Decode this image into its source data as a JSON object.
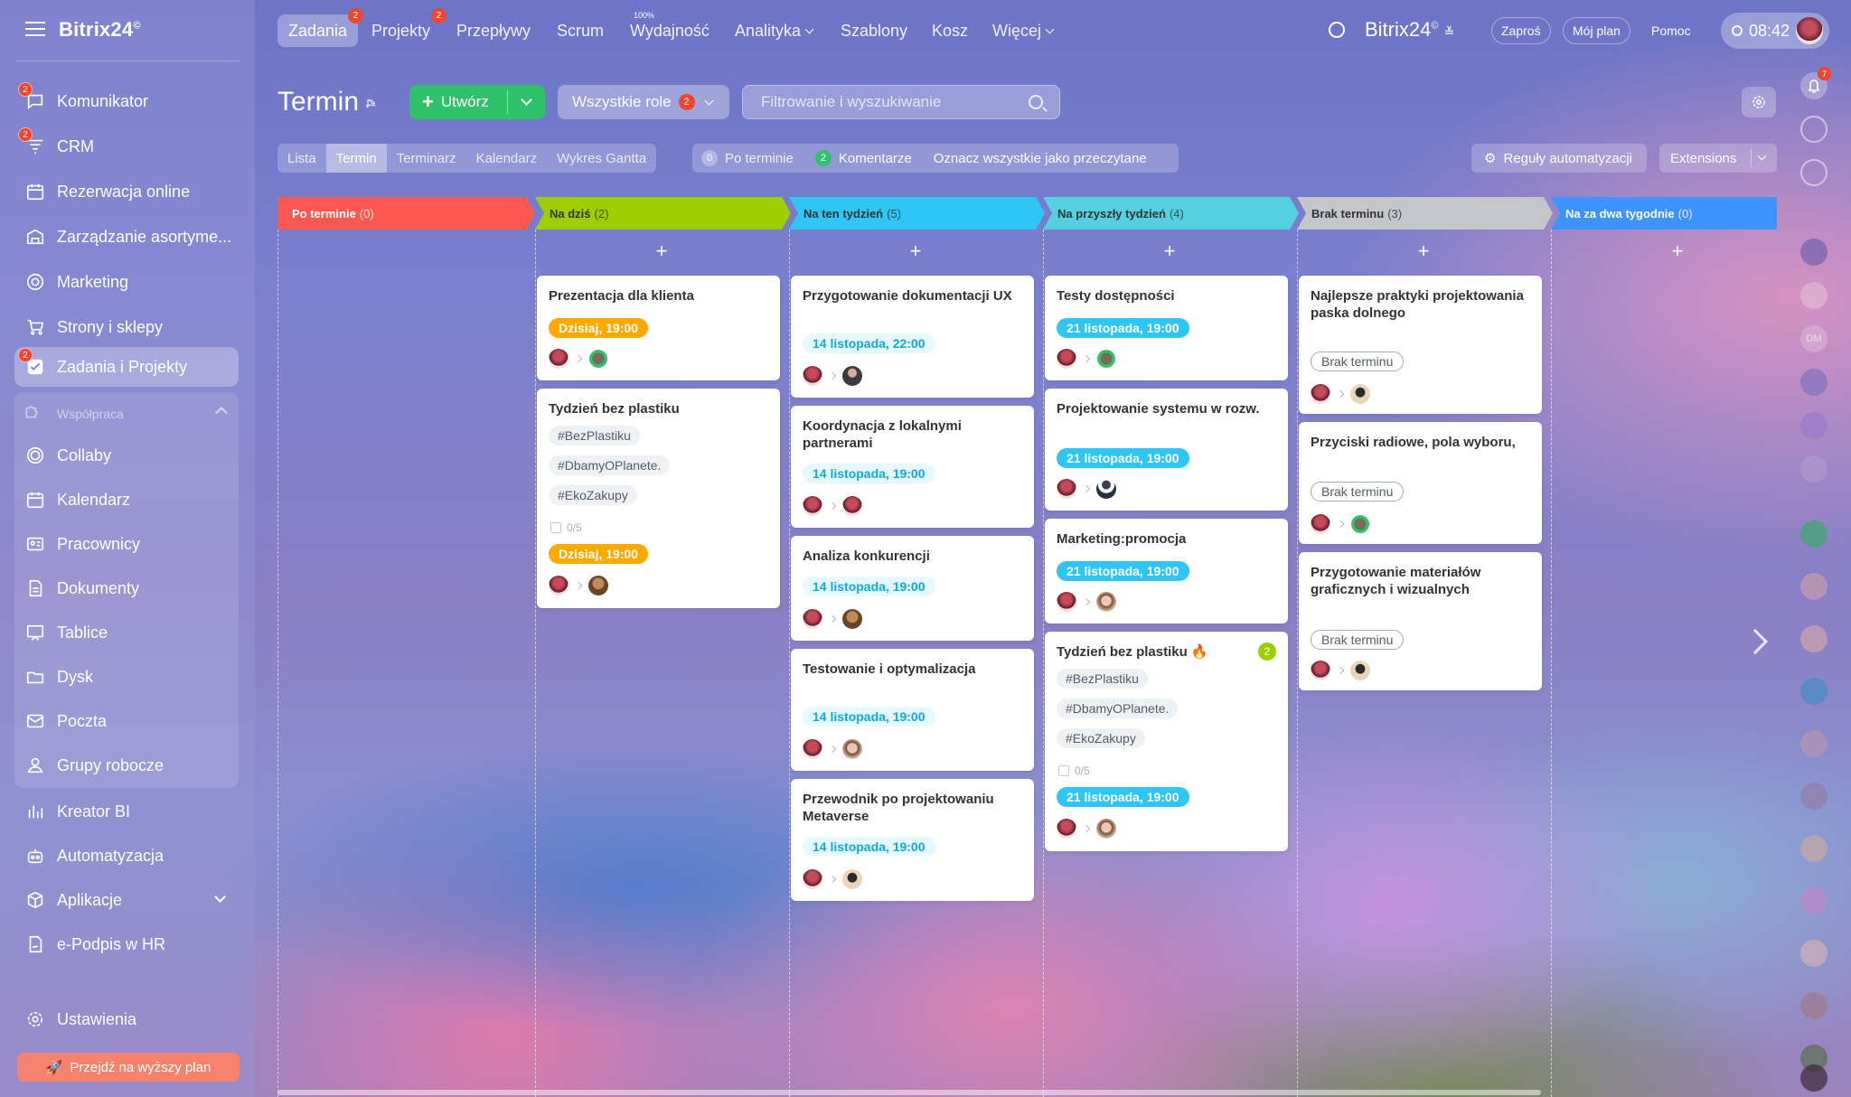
{
  "app": {
    "logo": "Bitrix24",
    "logo_mark": "©"
  },
  "sidebar": {
    "items": [
      {
        "label": "Komunikator",
        "badge": "2",
        "icon": "chat-icon"
      },
      {
        "label": "CRM",
        "badge": "2",
        "icon": "crm-funnel-icon"
      },
      {
        "label": "Rezerwacja online",
        "icon": "booking-calendar-icon"
      },
      {
        "label": "Zarządzanie asortyme...",
        "icon": "inventory-icon"
      },
      {
        "label": "Marketing",
        "icon": "target-icon"
      },
      {
        "label": "Strony i sklepy",
        "icon": "cart-icon"
      },
      {
        "label": "Zadania i Projekty",
        "badge": "2",
        "icon": "tasks-checkbox-icon"
      }
    ],
    "group_title": "Współpraca",
    "group_items": [
      {
        "label": "Collaby",
        "icon": "collab-icon"
      },
      {
        "label": "Kalendarz",
        "icon": "calendar-icon"
      },
      {
        "label": "Pracownicy",
        "icon": "employees-icon"
      },
      {
        "label": "Dokumenty",
        "icon": "documents-icon"
      },
      {
        "label": "Tablice",
        "icon": "boards-icon"
      },
      {
        "label": "Dysk",
        "icon": "drive-icon"
      },
      {
        "label": "Poczta",
        "icon": "mail-icon"
      },
      {
        "label": "Grupy robocze",
        "icon": "workgroups-icon"
      }
    ],
    "bottom_items": [
      {
        "label": "Kreator BI",
        "icon": "bar-chart-icon"
      },
      {
        "label": "Automatyzacja",
        "icon": "robot-icon"
      },
      {
        "label": "Aplikacje",
        "icon": "apps-cube-icon"
      },
      {
        "label": "e-Podpis w HR",
        "icon": "signature-icon"
      }
    ],
    "settings": "Ustawienia",
    "upgrade": "Przejdź na wyższy plan"
  },
  "topnav": {
    "items": [
      {
        "label": "Zadania",
        "badge": "2",
        "active": true
      },
      {
        "label": "Projekty",
        "badge": "2"
      },
      {
        "label": "Przepływy"
      },
      {
        "label": "Scrum"
      },
      {
        "label": "Wydajność",
        "sup": "100%"
      },
      {
        "label": "Analityka",
        "dropdown": true
      },
      {
        "label": "Szablony"
      },
      {
        "label": "Kosz"
      },
      {
        "label": "Więcej",
        "dropdown": true
      }
    ],
    "brand": "Bitrix24",
    "invite": "Zaproś",
    "my_plan": "Mój plan",
    "help": "Pomoc",
    "time": "08:42"
  },
  "page": {
    "title": "Termin",
    "create": "Utwórz",
    "roles": "Wszystkie role",
    "roles_badge": "2",
    "search_placeholder": "Filtrowanie i wyszukiwanie"
  },
  "views": [
    "Lista",
    "Termin",
    "Terminarz",
    "Kalendarz",
    "Wykres Gantta"
  ],
  "counters": {
    "overdue_count": "0",
    "overdue_label": "Po terminie",
    "comments_count": "2",
    "comments_label": "Komentarze",
    "mark_read": "Oznacz wszystkie jako przeczytane"
  },
  "automation": "Reguły automatyzacji",
  "extensions": "Extensions",
  "colors": {
    "overdue": "#ff5752",
    "today": "#9dcf00",
    "week": "#2fc6f6",
    "nextweek": "#55d0e0",
    "none": "#c3c6cb",
    "twoweeks": "#3e94ff"
  },
  "columns": [
    {
      "title": "Po terminie",
      "count": "(0)",
      "cards": []
    },
    {
      "title": "Na dziś",
      "count": "(2)",
      "cards": [
        {
          "title": "Prezentacja dla klienta",
          "deadline": "Dzisiaj, 19:00"
        },
        {
          "title": "Tydzień bez plastiku",
          "tags": [
            "#BezPlastiku",
            "#DbamyOPlanete.",
            "#EkoZakupy"
          ],
          "checklist": "0/5",
          "deadline": "Dzisiaj, 19:00"
        }
      ]
    },
    {
      "title": "Na ten tydzień",
      "count": "(5)",
      "cards": [
        {
          "title": "Przygotowanie dokumentacji UX",
          "deadline": "14 listopada, 22:00"
        },
        {
          "title": "Koordynacja z lokalnymi partnerami",
          "deadline": "14 listopada, 19:00"
        },
        {
          "title": "Analiza konkurencji",
          "deadline": "14 listopada, 19:00"
        },
        {
          "title": "Testowanie i optymalizacja",
          "deadline": "14 listopada, 19:00"
        },
        {
          "title": "Przewodnik po projektowaniu Metaverse",
          "deadline": "14 listopada, 19:00"
        }
      ]
    },
    {
      "title": "Na przyszły tydzień",
      "count": "(4)",
      "cards": [
        {
          "title": "Testy dostępności",
          "deadline": "21 listopada, 19:00"
        },
        {
          "title": "Projektowanie systemu w rozw.",
          "deadline": "21 listopada, 19:00"
        },
        {
          "title": "Marketing:promocja",
          "deadline": "21 listopada, 19:00"
        },
        {
          "title": "Tydzień bez plastiku",
          "comments": "2",
          "tags": [
            "#BezPlastiku",
            "#DbamyOPlanete.",
            "#EkoZakupy"
          ],
          "checklist": "0/5",
          "deadline": "21 listopada, 19:00"
        }
      ]
    },
    {
      "title": "Brak terminu",
      "count": "(3)",
      "cards": [
        {
          "title": "Najlepsze praktyki projektowania paska dolnego",
          "deadline": "Brak terminu"
        },
        {
          "title": "Przyciski radiowe, pola wyboru,",
          "deadline": "Brak terminu"
        },
        {
          "title": "Przygotowanie materiałów graficznych i wizualnych",
          "deadline": "Brak terminu"
        }
      ]
    },
    {
      "title": "Na za dwa tygodnie",
      "count": "(0)",
      "cards": []
    }
  ],
  "right_bar": {
    "notifications_badge": "7",
    "initials": "DM"
  }
}
